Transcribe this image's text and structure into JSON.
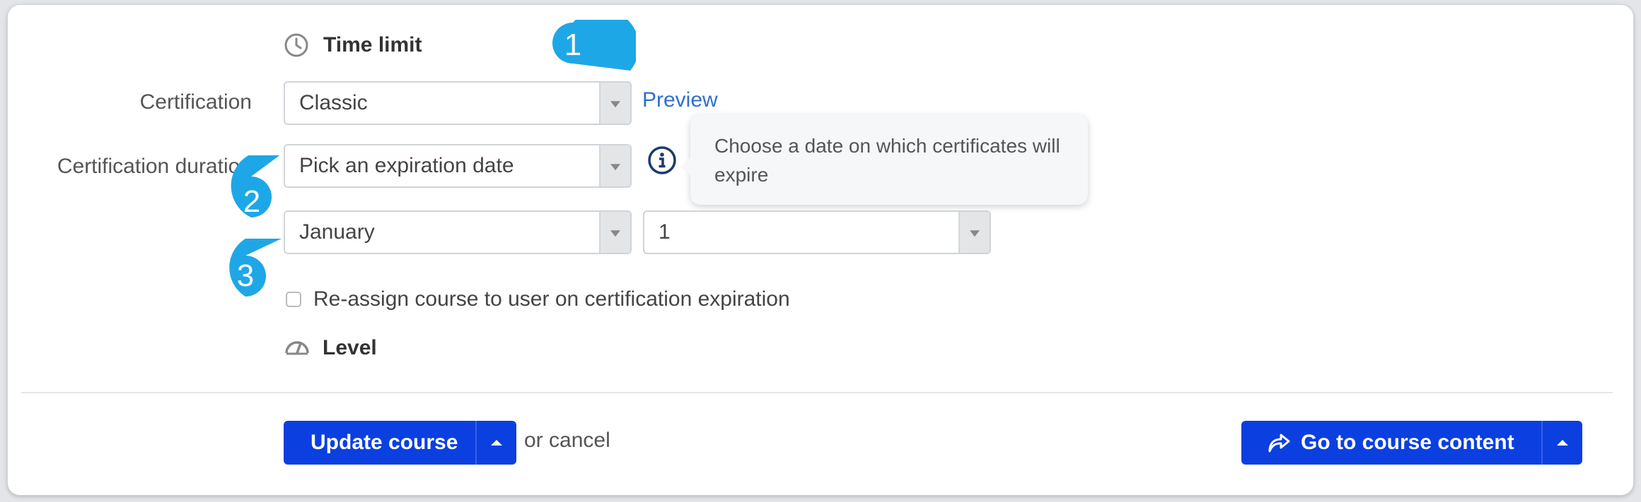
{
  "sections": {
    "time_limit": {
      "title": "Time limit",
      "icon": "clock-icon"
    },
    "level": {
      "title": "Level",
      "icon": "gauge-icon"
    }
  },
  "certification": {
    "label": "Certification",
    "selected": "Classic",
    "preview_link": "Preview"
  },
  "certification_duration": {
    "label": "Certification duration",
    "selected": "Pick an expiration date",
    "info_icon": "info-icon",
    "tooltip": "Choose a date on which certificates will expire"
  },
  "expiration_date": {
    "month": "January",
    "day": "1"
  },
  "reassign": {
    "label": "Re-assign course to user on certification expiration",
    "checked": false
  },
  "footer": {
    "update_button": "Update course",
    "or_cancel_prefix": "or ",
    "cancel_link": "cancel",
    "go_to_content_button": "Go to course content",
    "go_icon": "share-arrow-icon"
  },
  "annotations": [
    "1",
    "2",
    "3"
  ],
  "colors": {
    "primary_button": "#0b3fe0",
    "link": "#2e6fd1",
    "annotation_marker": "#1ea7e6"
  }
}
